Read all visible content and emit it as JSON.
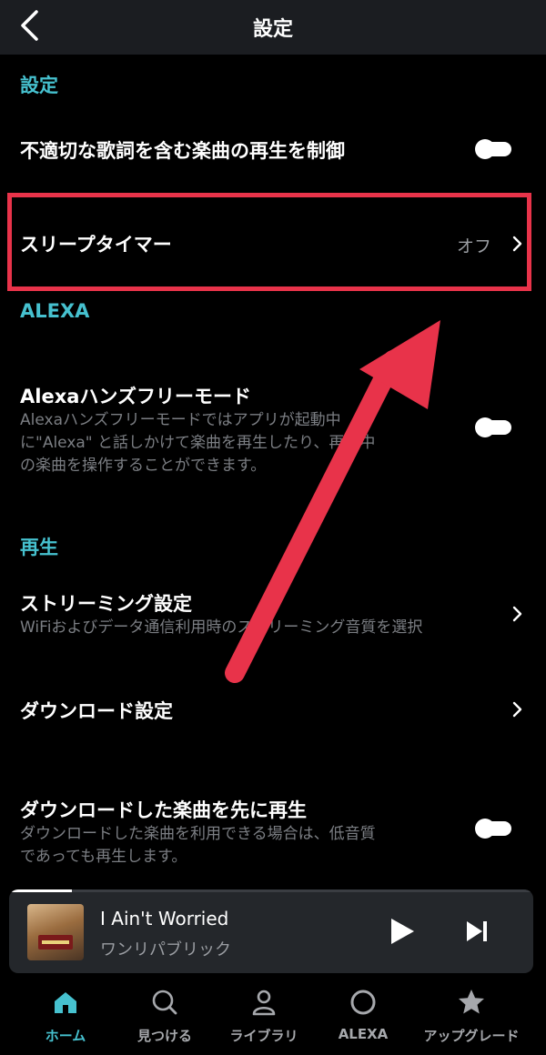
{
  "header": {
    "title": "設定"
  },
  "sections": {
    "settings": {
      "label": "設定"
    },
    "alexa": {
      "label": "ALEXA"
    },
    "playback": {
      "label": "再生"
    }
  },
  "rows": {
    "explicit": {
      "title": "不適切な歌詞を含む楽曲の再生を制御"
    },
    "sleep_timer": {
      "title": "スリープタイマー",
      "status": "オフ"
    },
    "alexa_handsfree": {
      "title": "Alexaハンズフリーモード",
      "description_lines": [
        "Alexaハンズフリーモードではアプリが起動中",
        "に\"Alexa\" と話しかけて楽曲を再生したり、再生中",
        "の楽曲を操作することができます。"
      ]
    },
    "streaming": {
      "title": "ストリーミング設定",
      "description": "WiFiおよびデータ通信利用時のストリーミング音質を選択"
    },
    "download": {
      "title": "ダウンロード設定"
    },
    "download_first": {
      "title": "ダウンロードした楽曲を先に再生",
      "description_lines": [
        "ダウンロードした楽曲を利用できる場合は、低音質",
        "であっても再生します。"
      ]
    }
  },
  "player": {
    "track_title": "I Ain't Worried",
    "artist": "ワンリパブリック",
    "progress": 0.12
  },
  "nav": [
    {
      "label": "ホーム",
      "icon": "home-icon",
      "active": true
    },
    {
      "label": "見つける",
      "icon": "search-icon",
      "active": false
    },
    {
      "label": "ライブラリ",
      "icon": "person-icon",
      "active": false
    },
    {
      "label": "ALEXA",
      "icon": "alexa-icon",
      "active": false
    },
    {
      "label": "アップグレード",
      "icon": "star-icon",
      "active": false
    }
  ],
  "colors": {
    "accent": "#46c1cf",
    "highlight": "#e8334a",
    "background": "#000000",
    "header": "#1b1d21"
  }
}
